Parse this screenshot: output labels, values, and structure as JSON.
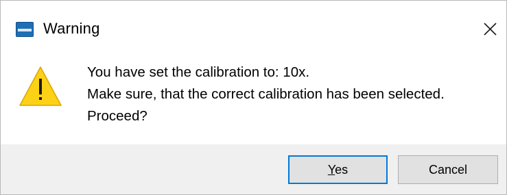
{
  "window": {
    "title": "Warning",
    "app_icon": "app-logo-icon",
    "close_icon": "close-icon"
  },
  "message": {
    "icon": "warning-triangle-icon",
    "lines": [
      "You have set the calibration to: 10x.",
      "Make sure, that the correct calibration has been selected.",
      "Proceed?"
    ]
  },
  "buttons": {
    "yes": {
      "label_mnemonic": "Y",
      "label_rest": "es"
    },
    "cancel": {
      "label": "Cancel"
    }
  },
  "colors": {
    "footer_bg": "#f0f0f0",
    "button_bg": "#e1e1e1",
    "default_button_border": "#0078d7",
    "warning_fill": "#fcd116"
  }
}
